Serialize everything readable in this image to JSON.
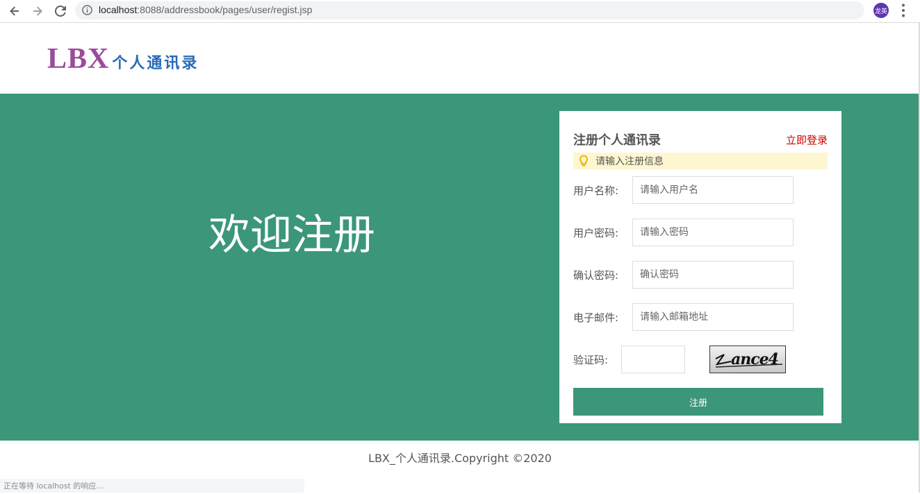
{
  "browser": {
    "url_host": "localhost",
    "url_path": ":8088/addressbook/pages/user/regist.jsp",
    "profile_label": "龙英"
  },
  "header": {
    "logo_latin": "LBX",
    "logo_chinese": "个人通讯录"
  },
  "banner": {
    "welcome_text": "欢迎注册"
  },
  "form": {
    "title": "注册个人通讯录",
    "login_link": "立即登录",
    "tip": "请输入注册信息",
    "username": {
      "label": "用户名称:",
      "placeholder": "请输入用户名",
      "value": ""
    },
    "password": {
      "label": "用户密码:",
      "placeholder": "请输入密码",
      "value": ""
    },
    "confirm": {
      "label": "确认密码:",
      "placeholder": "确认密码",
      "value": ""
    },
    "email": {
      "label": "电子邮件:",
      "placeholder": "请输入邮箱地址",
      "value": ""
    },
    "captcha": {
      "label": "验证码:",
      "value": "",
      "image_text": "ance4"
    },
    "submit_label": "注册"
  },
  "footer": {
    "copyright": "LBX_个人通讯录.Copyright ©2020"
  },
  "status_bar": {
    "text": "正在等待 localhost 的响应..."
  },
  "colors": {
    "brand_green": "#3b967a",
    "logo_purple": "#9b4a9e",
    "logo_blue": "#2a6bb5",
    "link_red": "#cc0000",
    "tip_bg": "#fdf6d0"
  }
}
